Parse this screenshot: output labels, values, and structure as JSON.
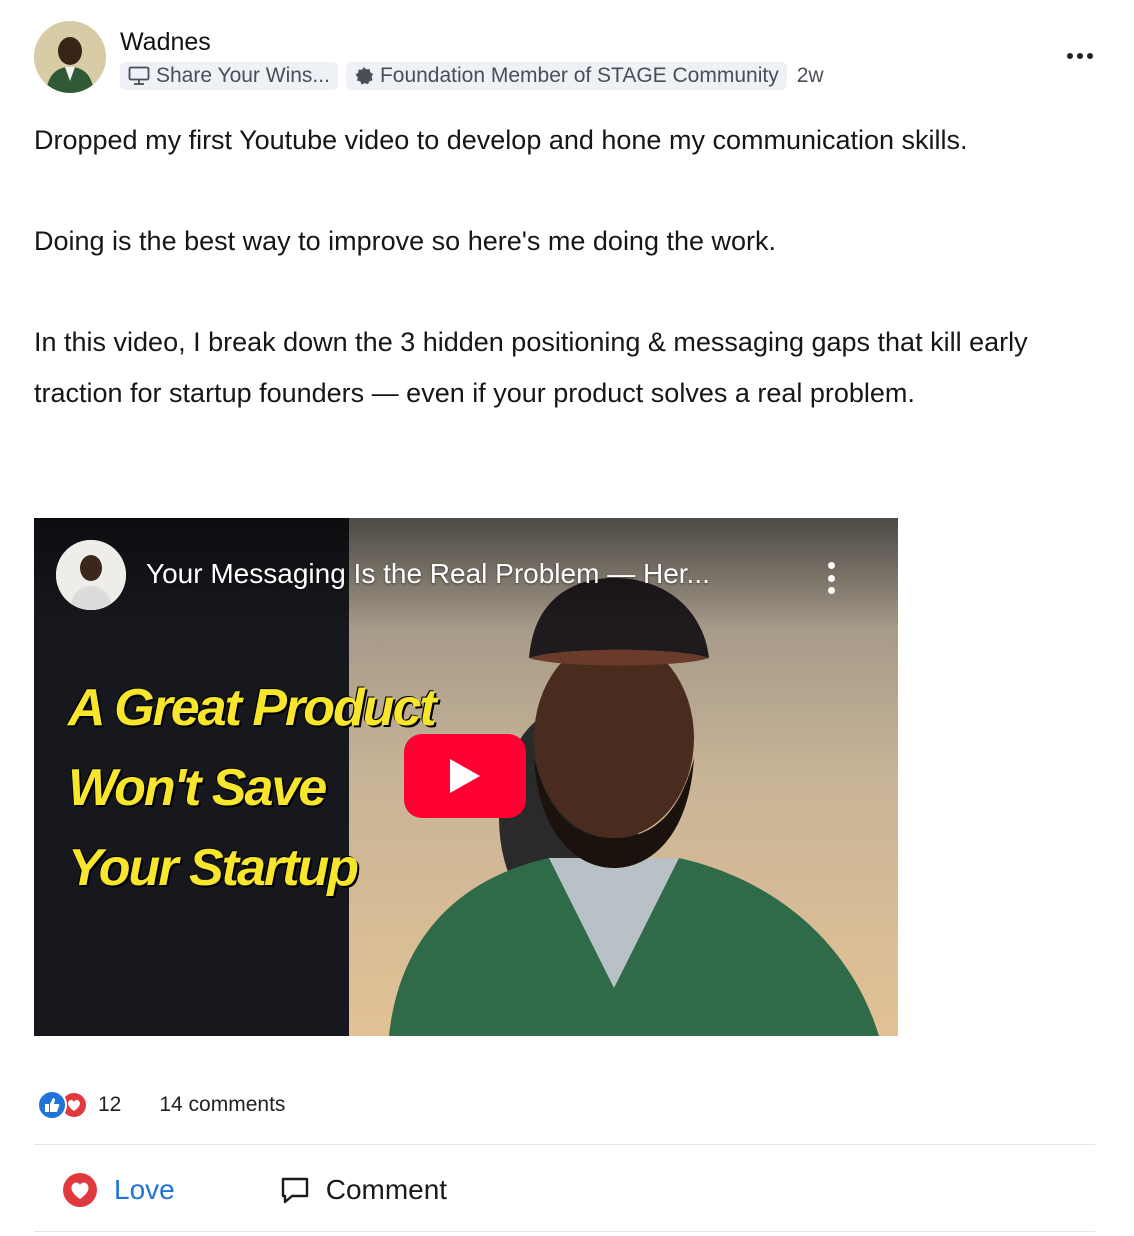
{
  "post": {
    "author": "Wadnes",
    "space": "Share Your Wins...",
    "badge": "Foundation Member of STAGE Community",
    "time": "2w",
    "paragraphs": [
      "Dropped my first Youtube video to develop and hone my communication skills.",
      "Doing is the best way to improve so here's me doing the work.",
      "In this video, I break down the 3 hidden positioning & messaging gaps that kill early traction for startup founders — even if your product solves a real problem."
    ]
  },
  "video": {
    "title": "Your Messaging Is the Real Problem — Her...",
    "thumbnail_lines": [
      "A Great Product",
      "Won't Save",
      "Your Startup"
    ],
    "play_color": "#ff0033",
    "headline_color": "#f7e62b"
  },
  "stats": {
    "reactions": "12",
    "comments": "14 comments"
  },
  "actions": {
    "love": "Love",
    "comment": "Comment"
  },
  "colors": {
    "accent": "#1f74d9",
    "love_icon": "#e0393e"
  }
}
